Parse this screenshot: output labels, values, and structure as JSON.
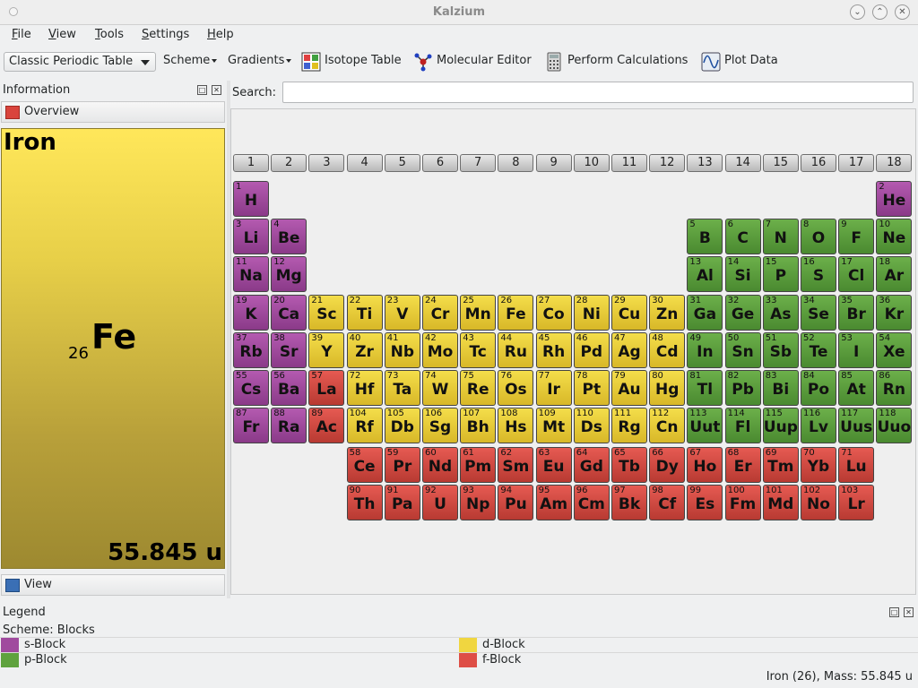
{
  "window": {
    "title": "Kalzium"
  },
  "menu": [
    "File",
    "View",
    "Tools",
    "Settings",
    "Help"
  ],
  "toolbar": {
    "table_select": "Classic Periodic Table",
    "scheme": "Scheme",
    "gradients": "Gradients",
    "isotope": "Isotope Table",
    "molecular": "Molecular Editor",
    "calculations": "Perform Calculations",
    "plot": "Plot Data"
  },
  "info": {
    "header": "Information",
    "overview": "Overview",
    "element_name": "Iron",
    "element_number": "26",
    "element_symbol": "Fe",
    "element_mass": "55.845 u",
    "view": "View"
  },
  "search": {
    "label": "Search:",
    "value": ""
  },
  "groups": [
    "1",
    "2",
    "3",
    "4",
    "5",
    "6",
    "7",
    "8",
    "9",
    "10",
    "11",
    "12",
    "13",
    "14",
    "15",
    "16",
    "17",
    "18"
  ],
  "colors": {
    "s": "#a04a9e",
    "p": "#5fa23e",
    "d": "#f0d640",
    "f": "#de4e46"
  },
  "elements": [
    {
      "n": "1",
      "s": "H",
      "r": 1,
      "c": 1,
      "b": "s"
    },
    {
      "n": "2",
      "s": "He",
      "r": 1,
      "c": 18,
      "b": "s"
    },
    {
      "n": "3",
      "s": "Li",
      "r": 2,
      "c": 1,
      "b": "s"
    },
    {
      "n": "4",
      "s": "Be",
      "r": 2,
      "c": 2,
      "b": "s"
    },
    {
      "n": "5",
      "s": "B",
      "r": 2,
      "c": 13,
      "b": "p"
    },
    {
      "n": "6",
      "s": "C",
      "r": 2,
      "c": 14,
      "b": "p"
    },
    {
      "n": "7",
      "s": "N",
      "r": 2,
      "c": 15,
      "b": "p"
    },
    {
      "n": "8",
      "s": "O",
      "r": 2,
      "c": 16,
      "b": "p"
    },
    {
      "n": "9",
      "s": "F",
      "r": 2,
      "c": 17,
      "b": "p"
    },
    {
      "n": "10",
      "s": "Ne",
      "r": 2,
      "c": 18,
      "b": "p"
    },
    {
      "n": "11",
      "s": "Na",
      "r": 3,
      "c": 1,
      "b": "s"
    },
    {
      "n": "12",
      "s": "Mg",
      "r": 3,
      "c": 2,
      "b": "s"
    },
    {
      "n": "13",
      "s": "Al",
      "r": 3,
      "c": 13,
      "b": "p"
    },
    {
      "n": "14",
      "s": "Si",
      "r": 3,
      "c": 14,
      "b": "p"
    },
    {
      "n": "15",
      "s": "P",
      "r": 3,
      "c": 15,
      "b": "p"
    },
    {
      "n": "16",
      "s": "S",
      "r": 3,
      "c": 16,
      "b": "p"
    },
    {
      "n": "17",
      "s": "Cl",
      "r": 3,
      "c": 17,
      "b": "p"
    },
    {
      "n": "18",
      "s": "Ar",
      "r": 3,
      "c": 18,
      "b": "p"
    },
    {
      "n": "19",
      "s": "K",
      "r": 4,
      "c": 1,
      "b": "s"
    },
    {
      "n": "20",
      "s": "Ca",
      "r": 4,
      "c": 2,
      "b": "s"
    },
    {
      "n": "21",
      "s": "Sc",
      "r": 4,
      "c": 3,
      "b": "d"
    },
    {
      "n": "22",
      "s": "Ti",
      "r": 4,
      "c": 4,
      "b": "d"
    },
    {
      "n": "23",
      "s": "V",
      "r": 4,
      "c": 5,
      "b": "d"
    },
    {
      "n": "24",
      "s": "Cr",
      "r": 4,
      "c": 6,
      "b": "d"
    },
    {
      "n": "25",
      "s": "Mn",
      "r": 4,
      "c": 7,
      "b": "d"
    },
    {
      "n": "26",
      "s": "Fe",
      "r": 4,
      "c": 8,
      "b": "d"
    },
    {
      "n": "27",
      "s": "Co",
      "r": 4,
      "c": 9,
      "b": "d"
    },
    {
      "n": "28",
      "s": "Ni",
      "r": 4,
      "c": 10,
      "b": "d"
    },
    {
      "n": "29",
      "s": "Cu",
      "r": 4,
      "c": 11,
      "b": "d"
    },
    {
      "n": "30",
      "s": "Zn",
      "r": 4,
      "c": 12,
      "b": "d"
    },
    {
      "n": "31",
      "s": "Ga",
      "r": 4,
      "c": 13,
      "b": "p"
    },
    {
      "n": "32",
      "s": "Ge",
      "r": 4,
      "c": 14,
      "b": "p"
    },
    {
      "n": "33",
      "s": "As",
      "r": 4,
      "c": 15,
      "b": "p"
    },
    {
      "n": "34",
      "s": "Se",
      "r": 4,
      "c": 16,
      "b": "p"
    },
    {
      "n": "35",
      "s": "Br",
      "r": 4,
      "c": 17,
      "b": "p"
    },
    {
      "n": "36",
      "s": "Kr",
      "r": 4,
      "c": 18,
      "b": "p"
    },
    {
      "n": "37",
      "s": "Rb",
      "r": 5,
      "c": 1,
      "b": "s"
    },
    {
      "n": "38",
      "s": "Sr",
      "r": 5,
      "c": 2,
      "b": "s"
    },
    {
      "n": "39",
      "s": "Y",
      "r": 5,
      "c": 3,
      "b": "d"
    },
    {
      "n": "40",
      "s": "Zr",
      "r": 5,
      "c": 4,
      "b": "d"
    },
    {
      "n": "41",
      "s": "Nb",
      "r": 5,
      "c": 5,
      "b": "d"
    },
    {
      "n": "42",
      "s": "Mo",
      "r": 5,
      "c": 6,
      "b": "d"
    },
    {
      "n": "43",
      "s": "Tc",
      "r": 5,
      "c": 7,
      "b": "d"
    },
    {
      "n": "44",
      "s": "Ru",
      "r": 5,
      "c": 8,
      "b": "d"
    },
    {
      "n": "45",
      "s": "Rh",
      "r": 5,
      "c": 9,
      "b": "d"
    },
    {
      "n": "46",
      "s": "Pd",
      "r": 5,
      "c": 10,
      "b": "d"
    },
    {
      "n": "47",
      "s": "Ag",
      "r": 5,
      "c": 11,
      "b": "d"
    },
    {
      "n": "48",
      "s": "Cd",
      "r": 5,
      "c": 12,
      "b": "d"
    },
    {
      "n": "49",
      "s": "In",
      "r": 5,
      "c": 13,
      "b": "p"
    },
    {
      "n": "50",
      "s": "Sn",
      "r": 5,
      "c": 14,
      "b": "p"
    },
    {
      "n": "51",
      "s": "Sb",
      "r": 5,
      "c": 15,
      "b": "p"
    },
    {
      "n": "52",
      "s": "Te",
      "r": 5,
      "c": 16,
      "b": "p"
    },
    {
      "n": "53",
      "s": "I",
      "r": 5,
      "c": 17,
      "b": "p"
    },
    {
      "n": "54",
      "s": "Xe",
      "r": 5,
      "c": 18,
      "b": "p"
    },
    {
      "n": "55",
      "s": "Cs",
      "r": 6,
      "c": 1,
      "b": "s"
    },
    {
      "n": "56",
      "s": "Ba",
      "r": 6,
      "c": 2,
      "b": "s"
    },
    {
      "n": "57",
      "s": "La",
      "r": 6,
      "c": 3,
      "b": "f"
    },
    {
      "n": "72",
      "s": "Hf",
      "r": 6,
      "c": 4,
      "b": "d"
    },
    {
      "n": "73",
      "s": "Ta",
      "r": 6,
      "c": 5,
      "b": "d"
    },
    {
      "n": "74",
      "s": "W",
      "r": 6,
      "c": 6,
      "b": "d"
    },
    {
      "n": "75",
      "s": "Re",
      "r": 6,
      "c": 7,
      "b": "d"
    },
    {
      "n": "76",
      "s": "Os",
      "r": 6,
      "c": 8,
      "b": "d"
    },
    {
      "n": "77",
      "s": "Ir",
      "r": 6,
      "c": 9,
      "b": "d"
    },
    {
      "n": "78",
      "s": "Pt",
      "r": 6,
      "c": 10,
      "b": "d"
    },
    {
      "n": "79",
      "s": "Au",
      "r": 6,
      "c": 11,
      "b": "d"
    },
    {
      "n": "80",
      "s": "Hg",
      "r": 6,
      "c": 12,
      "b": "d"
    },
    {
      "n": "81",
      "s": "Tl",
      "r": 6,
      "c": 13,
      "b": "p"
    },
    {
      "n": "82",
      "s": "Pb",
      "r": 6,
      "c": 14,
      "b": "p"
    },
    {
      "n": "83",
      "s": "Bi",
      "r": 6,
      "c": 15,
      "b": "p"
    },
    {
      "n": "84",
      "s": "Po",
      "r": 6,
      "c": 16,
      "b": "p"
    },
    {
      "n": "85",
      "s": "At",
      "r": 6,
      "c": 17,
      "b": "p"
    },
    {
      "n": "86",
      "s": "Rn",
      "r": 6,
      "c": 18,
      "b": "p"
    },
    {
      "n": "87",
      "s": "Fr",
      "r": 7,
      "c": 1,
      "b": "s"
    },
    {
      "n": "88",
      "s": "Ra",
      "r": 7,
      "c": 2,
      "b": "s"
    },
    {
      "n": "89",
      "s": "Ac",
      "r": 7,
      "c": 3,
      "b": "f"
    },
    {
      "n": "104",
      "s": "Rf",
      "r": 7,
      "c": 4,
      "b": "d"
    },
    {
      "n": "105",
      "s": "Db",
      "r": 7,
      "c": 5,
      "b": "d"
    },
    {
      "n": "106",
      "s": "Sg",
      "r": 7,
      "c": 6,
      "b": "d"
    },
    {
      "n": "107",
      "s": "Bh",
      "r": 7,
      "c": 7,
      "b": "d"
    },
    {
      "n": "108",
      "s": "Hs",
      "r": 7,
      "c": 8,
      "b": "d"
    },
    {
      "n": "109",
      "s": "Mt",
      "r": 7,
      "c": 9,
      "b": "d"
    },
    {
      "n": "110",
      "s": "Ds",
      "r": 7,
      "c": 10,
      "b": "d"
    },
    {
      "n": "111",
      "s": "Rg",
      "r": 7,
      "c": 11,
      "b": "d"
    },
    {
      "n": "112",
      "s": "Cn",
      "r": 7,
      "c": 12,
      "b": "d"
    },
    {
      "n": "113",
      "s": "Uut",
      "r": 7,
      "c": 13,
      "b": "p"
    },
    {
      "n": "114",
      "s": "Fl",
      "r": 7,
      "c": 14,
      "b": "p"
    },
    {
      "n": "115",
      "s": "Uup",
      "r": 7,
      "c": 15,
      "b": "p"
    },
    {
      "n": "116",
      "s": "Lv",
      "r": 7,
      "c": 16,
      "b": "p"
    },
    {
      "n": "117",
      "s": "Uus",
      "r": 7,
      "c": 17,
      "b": "p"
    },
    {
      "n": "118",
      "s": "Uuo",
      "r": 7,
      "c": 18,
      "b": "p"
    },
    {
      "n": "58",
      "s": "Ce",
      "r": 9,
      "c": 4,
      "b": "f"
    },
    {
      "n": "59",
      "s": "Pr",
      "r": 9,
      "c": 5,
      "b": "f"
    },
    {
      "n": "60",
      "s": "Nd",
      "r": 9,
      "c": 6,
      "b": "f"
    },
    {
      "n": "61",
      "s": "Pm",
      "r": 9,
      "c": 7,
      "b": "f"
    },
    {
      "n": "62",
      "s": "Sm",
      "r": 9,
      "c": 8,
      "b": "f"
    },
    {
      "n": "63",
      "s": "Eu",
      "r": 9,
      "c": 9,
      "b": "f"
    },
    {
      "n": "64",
      "s": "Gd",
      "r": 9,
      "c": 10,
      "b": "f"
    },
    {
      "n": "65",
      "s": "Tb",
      "r": 9,
      "c": 11,
      "b": "f"
    },
    {
      "n": "66",
      "s": "Dy",
      "r": 9,
      "c": 12,
      "b": "f"
    },
    {
      "n": "67",
      "s": "Ho",
      "r": 9,
      "c": 13,
      "b": "f"
    },
    {
      "n": "68",
      "s": "Er",
      "r": 9,
      "c": 14,
      "b": "f"
    },
    {
      "n": "69",
      "s": "Tm",
      "r": 9,
      "c": 15,
      "b": "f"
    },
    {
      "n": "70",
      "s": "Yb",
      "r": 9,
      "c": 16,
      "b": "f"
    },
    {
      "n": "71",
      "s": "Lu",
      "r": 9,
      "c": 17,
      "b": "f"
    },
    {
      "n": "90",
      "s": "Th",
      "r": 10,
      "c": 4,
      "b": "f"
    },
    {
      "n": "91",
      "s": "Pa",
      "r": 10,
      "c": 5,
      "b": "f"
    },
    {
      "n": "92",
      "s": "U",
      "r": 10,
      "c": 6,
      "b": "f"
    },
    {
      "n": "93",
      "s": "Np",
      "r": 10,
      "c": 7,
      "b": "f"
    },
    {
      "n": "94",
      "s": "Pu",
      "r": 10,
      "c": 8,
      "b": "f"
    },
    {
      "n": "95",
      "s": "Am",
      "r": 10,
      "c": 9,
      "b": "f"
    },
    {
      "n": "96",
      "s": "Cm",
      "r": 10,
      "c": 10,
      "b": "f"
    },
    {
      "n": "97",
      "s": "Bk",
      "r": 10,
      "c": 11,
      "b": "f"
    },
    {
      "n": "98",
      "s": "Cf",
      "r": 10,
      "c": 12,
      "b": "f"
    },
    {
      "n": "99",
      "s": "Es",
      "r": 10,
      "c": 13,
      "b": "f"
    },
    {
      "n": "100",
      "s": "Fm",
      "r": 10,
      "c": 14,
      "b": "f"
    },
    {
      "n": "101",
      "s": "Md",
      "r": 10,
      "c": 15,
      "b": "f"
    },
    {
      "n": "102",
      "s": "No",
      "r": 10,
      "c": 16,
      "b": "f"
    },
    {
      "n": "103",
      "s": "Lr",
      "r": 10,
      "c": 17,
      "b": "f"
    }
  ],
  "legend": {
    "title": "Legend",
    "scheme": "Scheme: Blocks",
    "items": [
      {
        "label": "s-Block",
        "color": "#a04a9e"
      },
      {
        "label": "d-Block",
        "color": "#f0d640"
      },
      {
        "label": "p-Block",
        "color": "#5fa23e"
      },
      {
        "label": "f-Block",
        "color": "#de4e46"
      }
    ]
  },
  "status": "Iron (26), Mass: 55.845 u"
}
